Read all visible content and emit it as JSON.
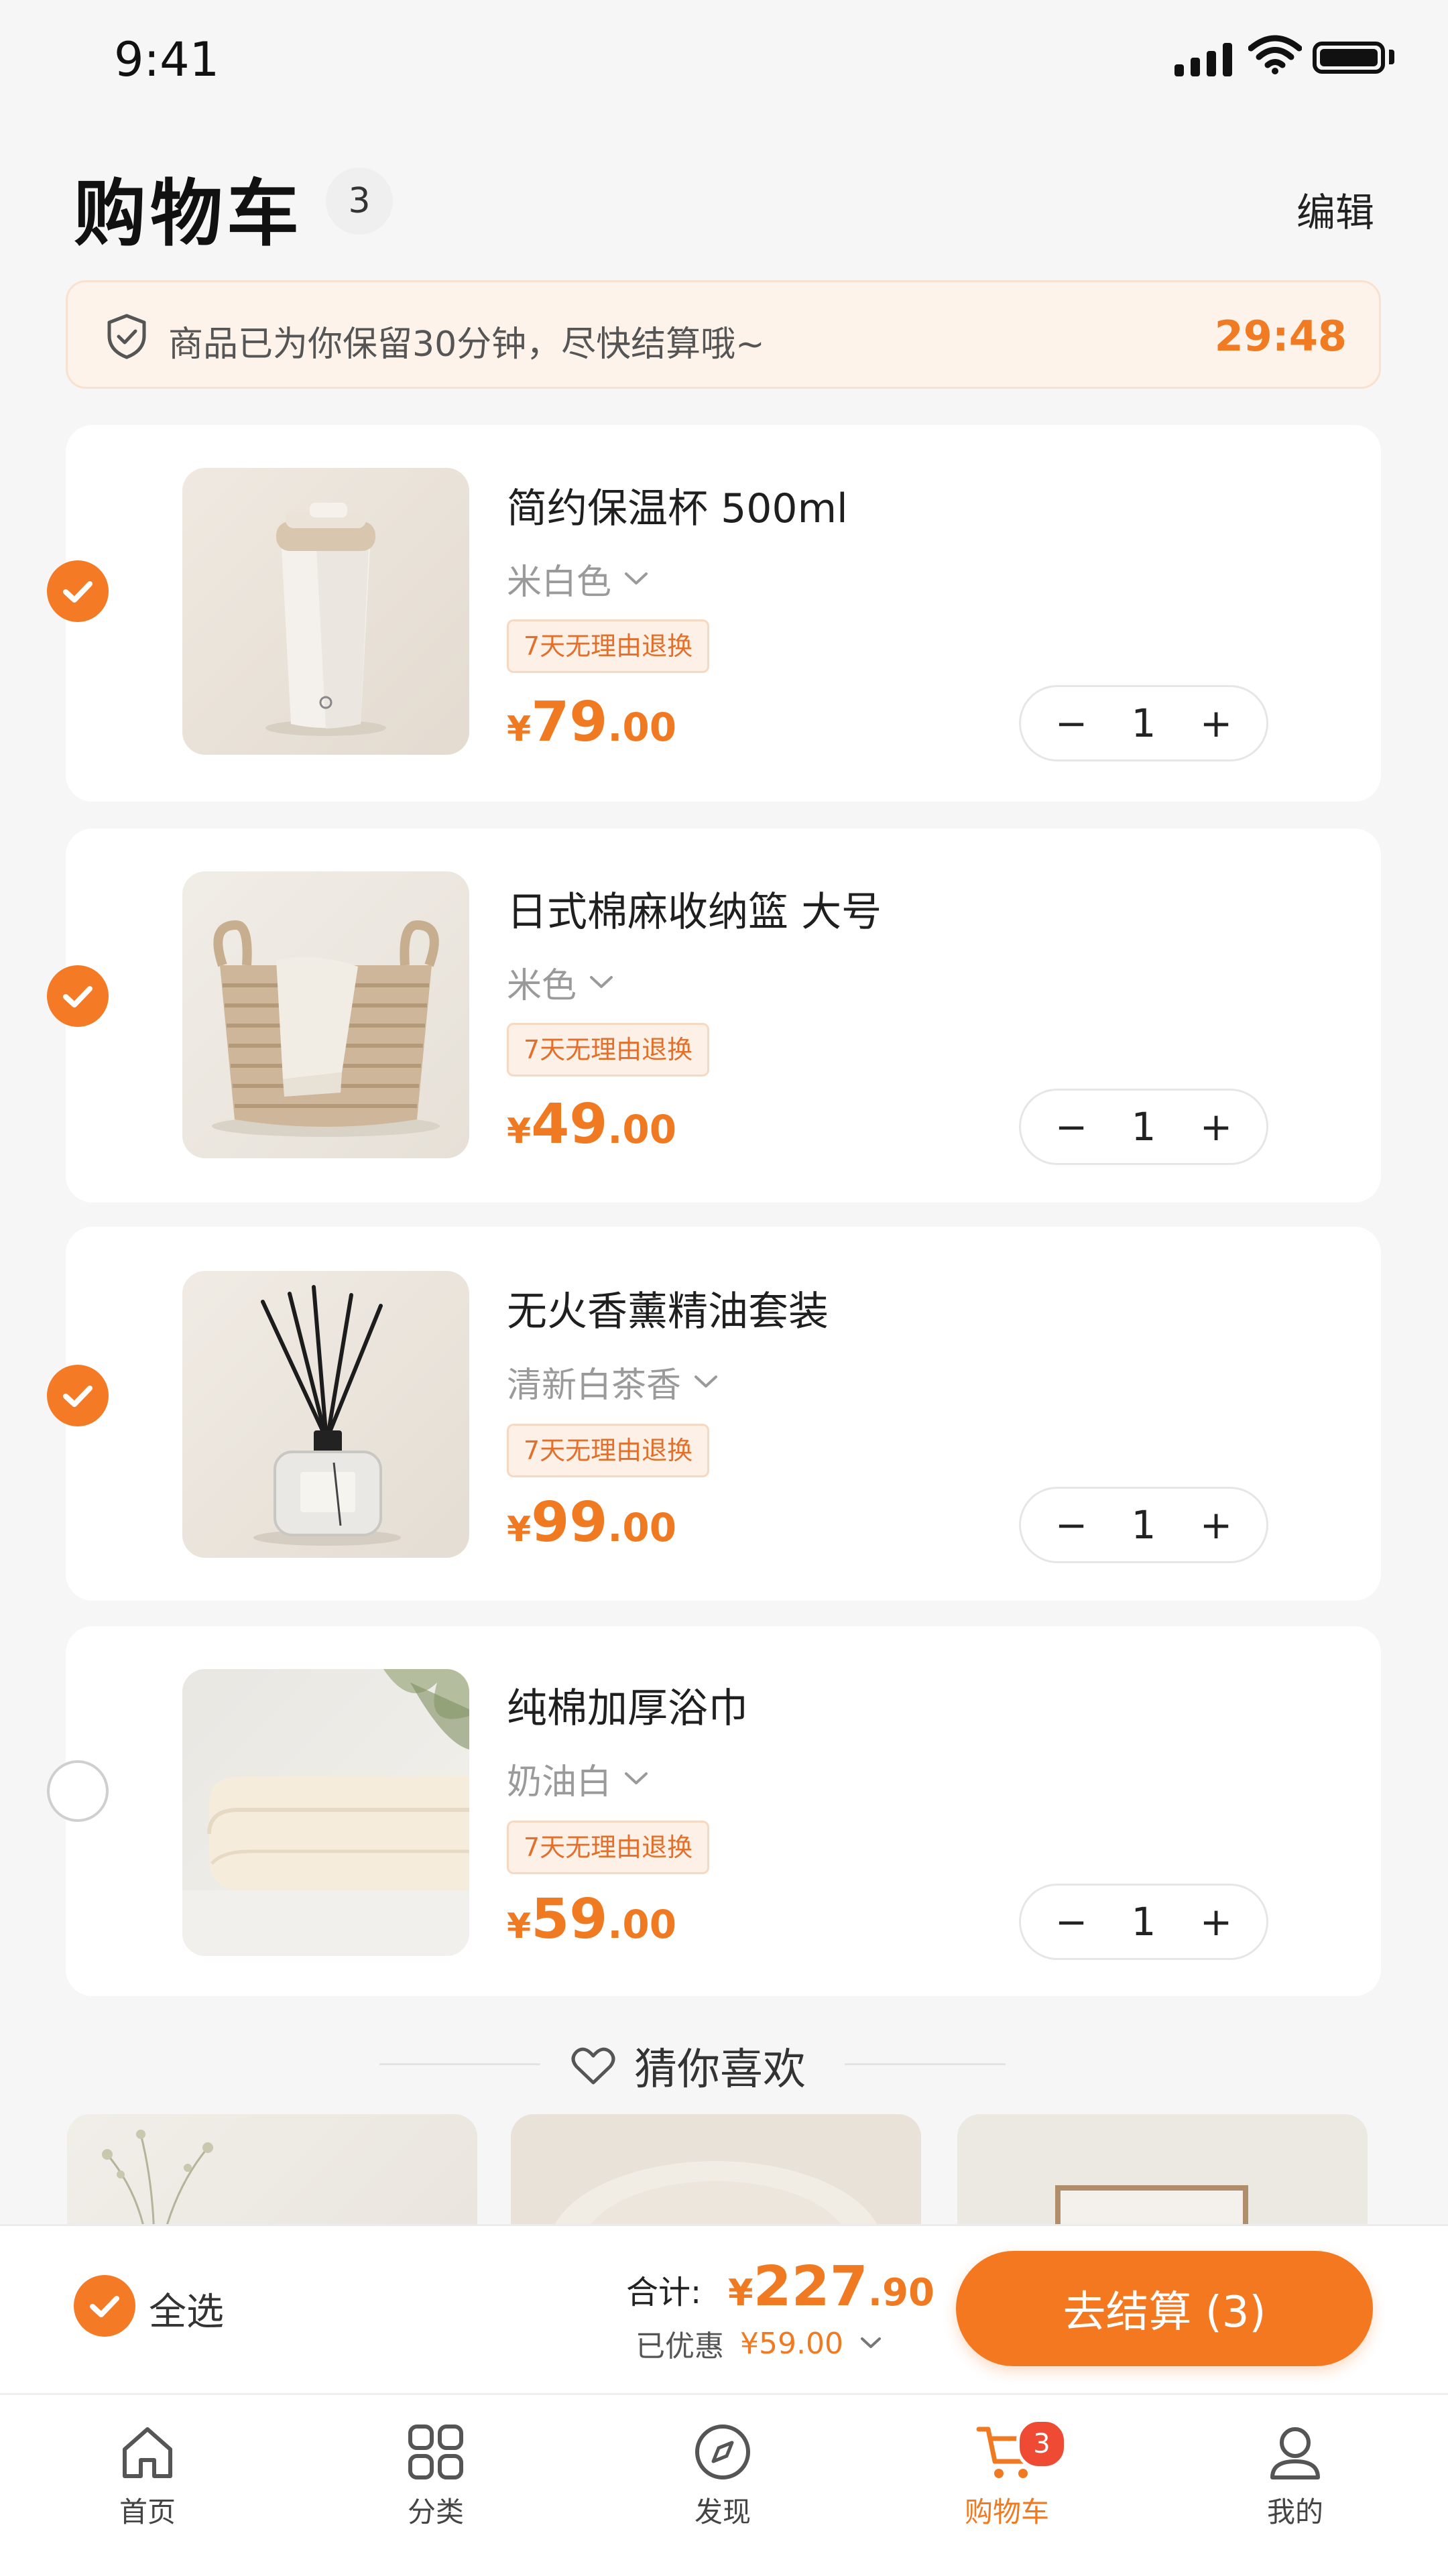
{
  "status_bar": {
    "time": "9:41"
  },
  "header": {
    "title": "购物车",
    "count": "3",
    "edit_label": "编辑"
  },
  "banner": {
    "text": "商品已为你保留30分钟，尽快结算哦~",
    "timer": "29:48"
  },
  "items": [
    {
      "name": "简约保温杯 500ml",
      "variant": "米白色",
      "tag": "7天无理由退换",
      "currency": "¥",
      "price_int": "79",
      "price_dec": ".00",
      "qty": "1",
      "checked": true
    },
    {
      "name": "日式棉麻收纳篮 大号",
      "variant": "米色",
      "tag": "7天无理由退换",
      "currency": "¥",
      "price_int": "49",
      "price_dec": ".00",
      "qty": "1",
      "checked": true
    },
    {
      "name": "无火香薰精油套装",
      "variant": "清新白茶香",
      "tag": "7天无理由退换",
      "currency": "¥",
      "price_int": "99",
      "price_dec": ".00",
      "qty": "1",
      "checked": true
    },
    {
      "name": "纯棉加厚浴巾",
      "variant": "奶油白",
      "tag": "7天无理由退换",
      "currency": "¥",
      "price_int": "59",
      "price_dec": ".00",
      "qty": "1",
      "checked": false
    }
  ],
  "stepper": {
    "minus": "−",
    "plus": "+"
  },
  "recommend": {
    "title": "猜你喜欢"
  },
  "checkout": {
    "select_all": "全选",
    "total_label": "合计:",
    "currency": "¥",
    "total_int": "227",
    "total_dec": ".90",
    "discount_label": "已优惠",
    "discount_value": "¥59.00",
    "pay_label": "去结算 (3)"
  },
  "tabs": [
    {
      "label": "首页",
      "icon": "home-icon"
    },
    {
      "label": "分类",
      "icon": "grid-icon"
    },
    {
      "label": "发现",
      "icon": "compass-icon"
    },
    {
      "label": "购物车",
      "icon": "cart-icon",
      "badge": "3",
      "active": true
    },
    {
      "label": "我的",
      "icon": "user-icon"
    }
  ],
  "colors": {
    "accent": "#f47a25",
    "badge": "#ee4a34",
    "banner_bg": "#fdf3ea"
  }
}
